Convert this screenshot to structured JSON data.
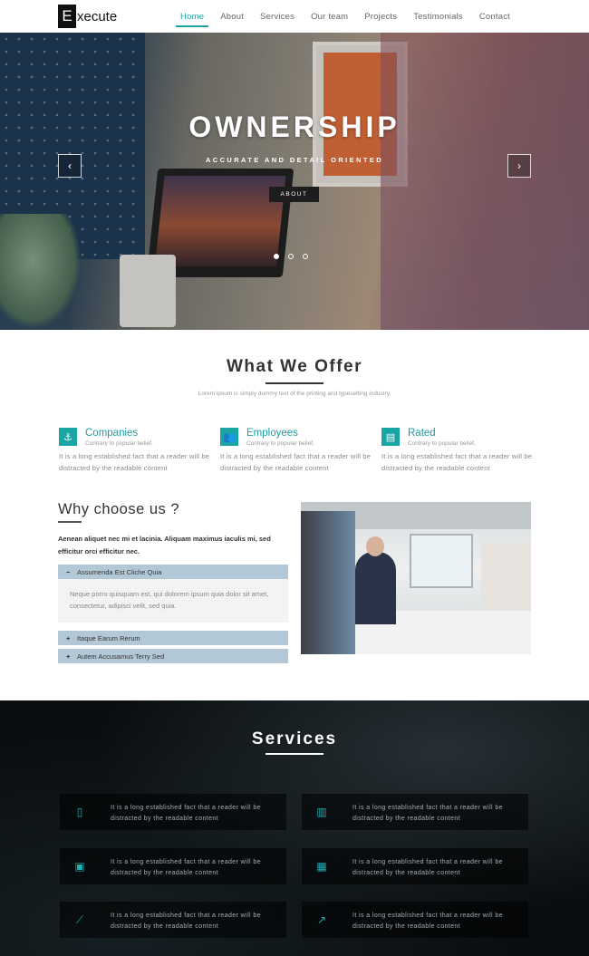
{
  "nav": {
    "logo_letter": "E",
    "logo_rest": "xecute",
    "items": [
      {
        "label": "Home",
        "active": true
      },
      {
        "label": "About"
      },
      {
        "label": "Services"
      },
      {
        "label": "Our team"
      },
      {
        "label": "Projects"
      },
      {
        "label": "Testimonials"
      },
      {
        "label": "Contact"
      }
    ]
  },
  "hero": {
    "title": "OWNERSHIP",
    "subtitle": "ACCURATE AND DETAIL ORIENTED",
    "button_label": "ABOUT",
    "prev_arrow": "‹",
    "next_arrow": "›",
    "slide_count": 3,
    "active_slide": 1
  },
  "offer": {
    "title": "What We Offer",
    "subtitle": "Lorem ipsum is simply dummy text of the printing and typesetting industry.",
    "features": [
      {
        "icon": "anchor-icon",
        "glyph": "⚓",
        "title": "Companies",
        "tagline": "Contrary to popular belief,",
        "text": "It is a long established fact that a reader will be distracted by the readable content"
      },
      {
        "icon": "users-icon",
        "glyph": "👥",
        "title": "Employees",
        "tagline": "Contrary to popular belief,",
        "text": "It is a long established fact that a reader will be distracted by the readable content"
      },
      {
        "icon": "certificate-icon",
        "glyph": "▤",
        "title": "Rated",
        "tagline": "Contrary to popular belief,",
        "text": "It is a long established fact that a reader will be distracted by the readable content"
      }
    ]
  },
  "why": {
    "title": "Why choose us ?",
    "lead": "Aenean aliquet nec mi et lacinia. Aliquam maximus iaculis mi, sed efficitur orci efficitur nec.",
    "accordion": [
      {
        "sign": "−",
        "label": "Assumenda Est Cliche Quia",
        "open": true,
        "body": "Neque porro quisquam est, qui dolorem ipsum quia dolor sit amet, consectetur, adipisci velit, sed quia."
      },
      {
        "sign": "+",
        "label": "Itaque Earum Rerum",
        "open": false
      },
      {
        "sign": "+",
        "label": "Autem Accusamus Terry Sed",
        "open": false
      }
    ]
  },
  "services": {
    "title": "Services",
    "items": [
      {
        "icon": "mobile-icon",
        "glyph": "▯",
        "text": "It is a long established fact that a reader will be distracted by the readable content"
      },
      {
        "icon": "bar-chart-icon",
        "glyph": "▥",
        "text": "It is a long established fact that a reader will be distracted by the readable content"
      },
      {
        "icon": "briefcase-icon",
        "glyph": "▣",
        "text": "It is a long established fact that a reader will be distracted by the readable content"
      },
      {
        "icon": "calendar-icon",
        "glyph": "▦",
        "text": "It is a long established fact that a reader will be distracted by the readable content"
      },
      {
        "icon": "line-chart-icon",
        "glyph": "⟋",
        "text": "It is a long established fact that a reader will be distracted by the readable content"
      },
      {
        "icon": "external-link-icon",
        "glyph": "↗",
        "text": "It is a long established fact that a reader will be distracted by the readable content"
      }
    ]
  },
  "colors": {
    "accent": "#1ba5a5",
    "accordion_header": "#b3c8d6",
    "services_bg": "#0a0e10"
  }
}
